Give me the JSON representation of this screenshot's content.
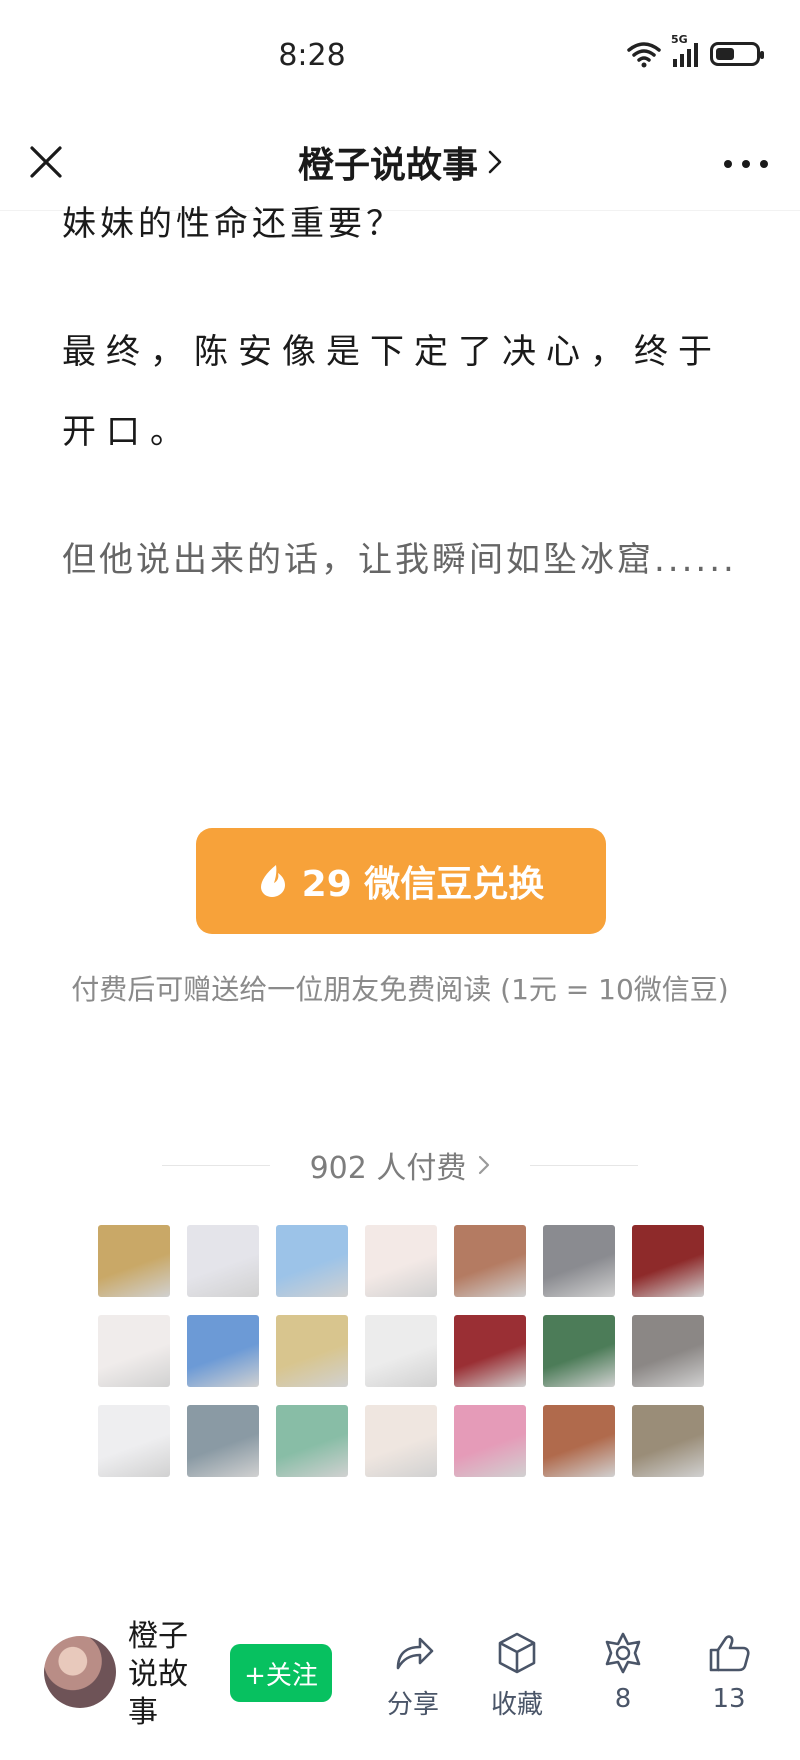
{
  "status_bar": {
    "time": "8:28",
    "network_label": "5G"
  },
  "nav": {
    "title": "橙子说故事",
    "close_icon": "close-icon",
    "more_icon": "more-icon"
  },
  "article": {
    "paragraphs": [
      "妹妹的性命还重要？",
      "最终，陈安像是下定了决心，终于开口。",
      "但他说出来的话，让我瞬间如坠冰窟......"
    ]
  },
  "paywall": {
    "button_label": "29 微信豆兑换",
    "note": "付费后可赠送给一位朋友免费阅读 (1元 = 10微信豆)",
    "button_color": "#f7a23a"
  },
  "payers": {
    "label": "902 人付费",
    "avatars": [
      "#c9a867",
      "#e4e4ea",
      "#9cc3e8",
      "#f3e9e6",
      "#b47b62",
      "#8a8b90",
      "#8e2a2a",
      "#f0eceb",
      "#6c9ad6",
      "#d8c58e",
      "#ececec",
      "#9a2f34",
      "#4c7c58",
      "#8b8785",
      "#eeeef0",
      "#8a9aa4",
      "#88bda6",
      "#efe6e0",
      "#e59bb8",
      "#b06a4c",
      "#9a8d78"
    ]
  },
  "bottom_bar": {
    "author_name": "橙子说故事",
    "follow_label": "+关注",
    "follow_color": "#07c160",
    "share_label": "分享",
    "collect_label": "收藏",
    "recommend_count": "8",
    "like_count": "13"
  }
}
